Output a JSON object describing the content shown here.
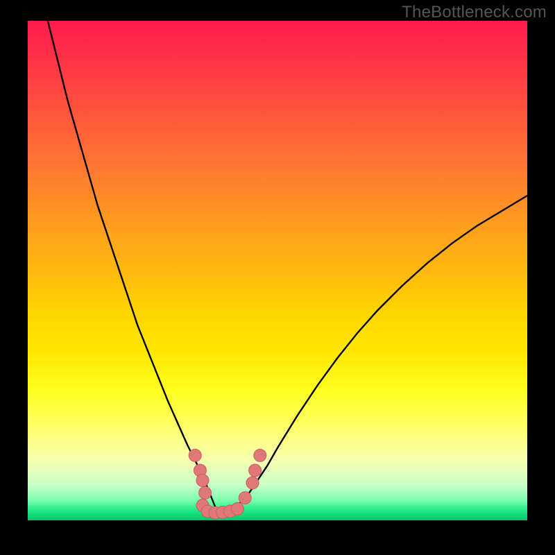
{
  "watermark": "TheBottleneck.com",
  "colors": {
    "frame_bg": "#000000",
    "curve_stroke": "#000000",
    "marker_fill": "#e07878",
    "marker_stroke": "#c86060"
  },
  "chart_data": {
    "type": "line",
    "title": "",
    "xlabel": "",
    "ylabel": "",
    "xlim": [
      0,
      100
    ],
    "ylim": [
      0,
      100
    ],
    "grid": false,
    "legend": false,
    "series": [
      {
        "name": "left-curve",
        "x": [
          4,
          6,
          8,
          10,
          12,
          14,
          16,
          18,
          20,
          22,
          24,
          26,
          28,
          30,
          32,
          33,
          34,
          35,
          36,
          37,
          38
        ],
        "y": [
          100,
          92,
          84,
          77,
          70,
          63,
          57,
          51,
          45,
          39,
          34,
          29,
          24,
          19.5,
          15,
          13,
          11,
          9,
          6.5,
          4,
          1.5
        ]
      },
      {
        "name": "right-curve",
        "x": [
          38,
          40,
          42,
          44,
          46,
          48,
          50,
          54,
          58,
          62,
          66,
          70,
          75,
          80,
          85,
          90,
          95,
          100
        ],
        "y": [
          1.5,
          2,
          3,
          5,
          8,
          11,
          14.5,
          21,
          27,
          32.5,
          37.5,
          42,
          47,
          51.5,
          55.5,
          59,
          62,
          65
        ]
      }
    ],
    "markers": [
      {
        "x": 33.5,
        "y": 13
      },
      {
        "x": 34.5,
        "y": 10
      },
      {
        "x": 35.0,
        "y": 8
      },
      {
        "x": 35.5,
        "y": 5.5
      },
      {
        "x": 35.0,
        "y": 3
      },
      {
        "x": 36.0,
        "y": 1.8
      },
      {
        "x": 37.5,
        "y": 1.5
      },
      {
        "x": 39.0,
        "y": 1.6
      },
      {
        "x": 40.5,
        "y": 1.8
      },
      {
        "x": 42.0,
        "y": 2.3
      },
      {
        "x": 43.5,
        "y": 4.5
      },
      {
        "x": 45.0,
        "y": 7.5
      },
      {
        "x": 45.5,
        "y": 10
      },
      {
        "x": 46.5,
        "y": 13
      }
    ]
  }
}
